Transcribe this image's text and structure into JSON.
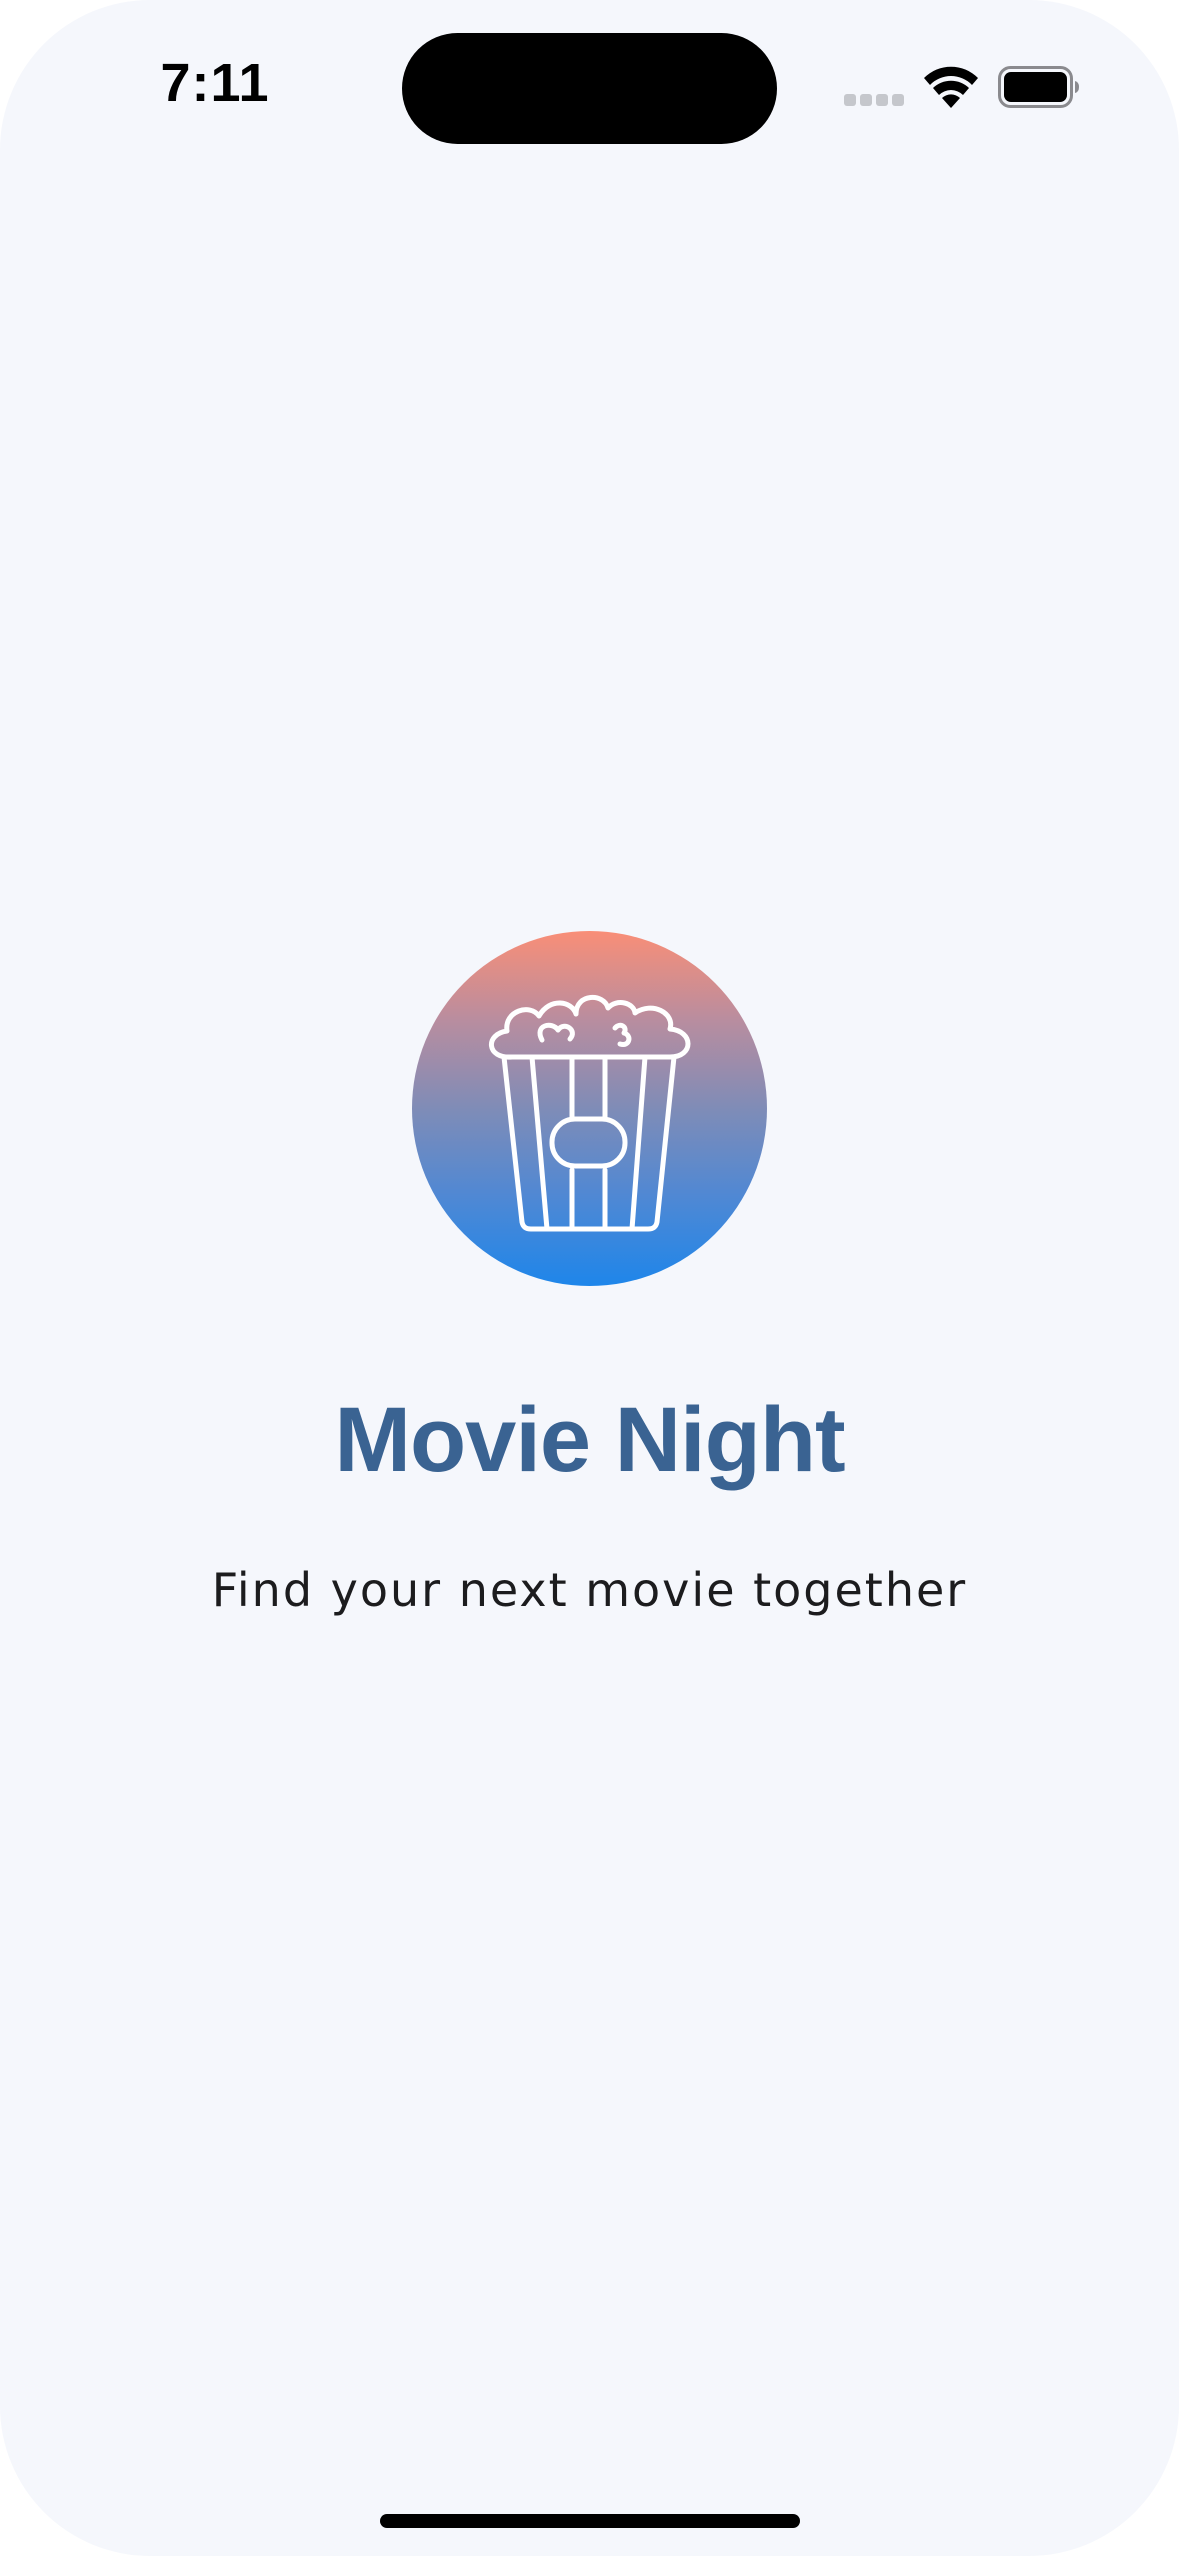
{
  "status_bar": {
    "time": "7:11",
    "icons": [
      "cellular-signal-icon",
      "wifi-icon",
      "battery-icon"
    ]
  },
  "splash": {
    "logo_icon": "popcorn-icon",
    "title": "Movie Night",
    "subtitle": "Find your next movie together"
  },
  "colors": {
    "background": "#f5f7fc",
    "title": "#3a6392",
    "subtitle": "#1c1c1e",
    "logo_gradient_top": "#f98e77",
    "logo_gradient_bottom": "#1e86ea"
  }
}
